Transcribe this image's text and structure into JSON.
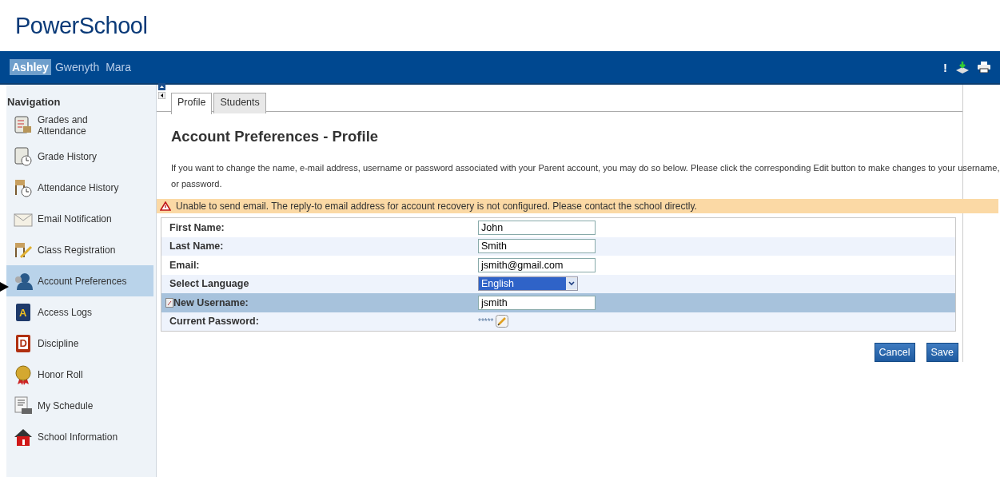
{
  "logo": "PowerSchool",
  "students": [
    {
      "name": "Ashley",
      "selected": true
    },
    {
      "name": "Gwenyth",
      "selected": false
    },
    {
      "name": "Mara",
      "selected": false
    }
  ],
  "header_icons": [
    "!"
  ],
  "navigation": {
    "title": "Navigation",
    "items": [
      {
        "label": "Grades and Attendance",
        "selected": false
      },
      {
        "label": "Grade History",
        "selected": false
      },
      {
        "label": "Attendance History",
        "selected": false
      },
      {
        "label": "Email Notification",
        "selected": false
      },
      {
        "label": "Class Registration",
        "selected": false
      },
      {
        "label": "Account Preferences",
        "selected": true
      },
      {
        "label": "Access Logs",
        "icon_letter": "A",
        "selected": false
      },
      {
        "label": "Discipline",
        "icon_letter": "D",
        "selected": false
      },
      {
        "label": "Honor Roll",
        "selected": false
      },
      {
        "label": "My Schedule",
        "selected": false
      },
      {
        "label": "School Information",
        "selected": false
      }
    ]
  },
  "tabs": [
    {
      "label": "Profile",
      "selected": true
    },
    {
      "label": "Students",
      "selected": false
    }
  ],
  "heading": "Account Preferences - Profile",
  "intro": "If you want to change the name, e-mail address, username or password associated with your Parent account, you may do so below. Please click the corresponding Edit button to make changes to your username, or password.",
  "warning": "Unable to send email. The reply-to email address for account recovery is not configured. Please contact the school directly.",
  "form_rows": [
    {
      "kind": "text",
      "label": "First Name:",
      "value": "John",
      "highlighted": false
    },
    {
      "kind": "text",
      "label": "Last Name:",
      "value": "Smith",
      "highlighted": false
    },
    {
      "kind": "text",
      "label": "Email:",
      "value": "jsmith@gmail.com",
      "highlighted": false
    },
    {
      "kind": "select",
      "label": "Select Language",
      "value": "English",
      "highlighted": false
    },
    {
      "kind": "text",
      "label": "New Username:",
      "value": "jsmith",
      "highlighted": true
    },
    {
      "kind": "password",
      "label": "Current Password:",
      "value": "*****",
      "highlighted": false
    }
  ],
  "buttons": [
    "Cancel",
    "Save"
  ]
}
